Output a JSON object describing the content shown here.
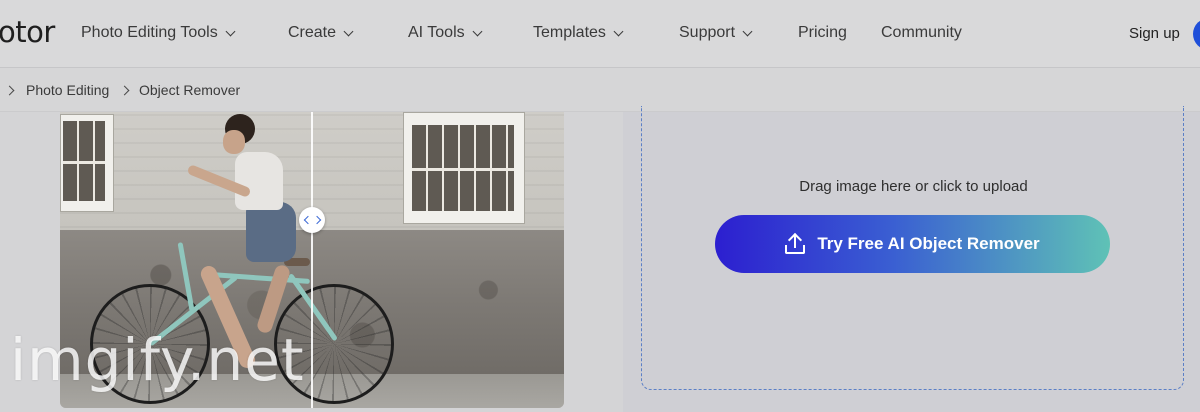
{
  "brand": {
    "logo_text": "otor"
  },
  "nav": {
    "items": [
      {
        "label": "Photo Editing Tools",
        "has_dropdown": true
      },
      {
        "label": "Create",
        "has_dropdown": true
      },
      {
        "label": "AI Tools",
        "has_dropdown": true
      },
      {
        "label": "Templates",
        "has_dropdown": true
      },
      {
        "label": "Support",
        "has_dropdown": true
      },
      {
        "label": "Pricing",
        "has_dropdown": false
      },
      {
        "label": "Community",
        "has_dropdown": false
      }
    ],
    "signup_label": "Sign up"
  },
  "breadcrumb": {
    "items": [
      "Photo Editing",
      "Object Remover"
    ]
  },
  "upload": {
    "drop_text": "Drag image here or click to upload",
    "button_label": "Try Free AI Object Remover",
    "icon": "upload-icon"
  },
  "demo": {
    "icon": "compare-slider-icon"
  },
  "watermark": {
    "text": "imgify.net"
  },
  "colors": {
    "button_gradient_start": "#2c1fd0",
    "button_gradient_end": "#5fc2b6",
    "dropzone_border": "#5b7fc6",
    "avatar": "#1f4fd9"
  }
}
